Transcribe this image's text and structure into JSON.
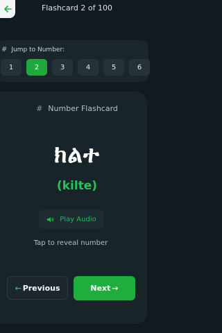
{
  "header": {
    "title": "Flashcard 2 of 100",
    "back_icon": "arrow-left-icon"
  },
  "jump": {
    "label": "Jump to Number:",
    "icon": "hash-icon",
    "numbers": [
      "1",
      "2",
      "3",
      "4",
      "5",
      "6"
    ],
    "selected": "2"
  },
  "card": {
    "title": "Number Flashcard",
    "title_icon": "hash-icon",
    "word": "ክልተ",
    "transliteration": "(kilte)",
    "audio_label": "Play Audio",
    "audio_icon": "speaker-icon",
    "hint": "Tap to reveal number"
  },
  "nav": {
    "previous_label": "Previous",
    "next_label": "Next"
  },
  "colors": {
    "accent": "#1fae3e",
    "background": "#111a20",
    "card": "#18232a"
  }
}
